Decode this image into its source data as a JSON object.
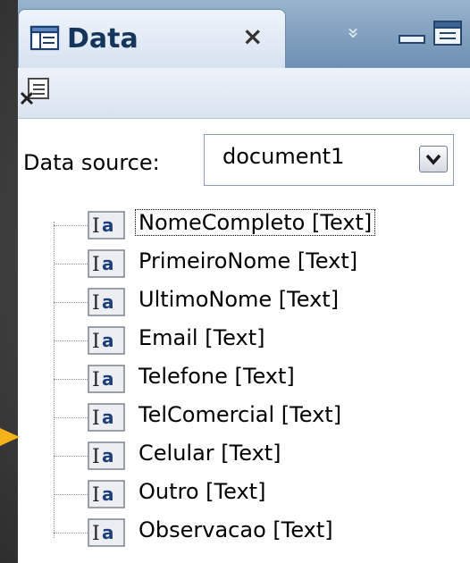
{
  "panel": {
    "title": "Data",
    "close_glyph": "×",
    "chevron_glyph": "»"
  },
  "icons": {
    "tab": "data-panel-icon",
    "toolbar": "remove-data-source-icon",
    "field": "text-field-icon"
  },
  "data_source": {
    "label": "Data source:",
    "value": "document1"
  },
  "fields": [
    {
      "label": "NomeCompleto [Text]",
      "selected": true
    },
    {
      "label": "PrimeiroNome [Text]",
      "selected": false
    },
    {
      "label": "UltimoNome [Text]",
      "selected": false
    },
    {
      "label": "Email [Text]",
      "selected": false
    },
    {
      "label": "Telefone [Text]",
      "selected": false
    },
    {
      "label": "TelComercial [Text]",
      "selected": false
    },
    {
      "label": "Celular [Text]",
      "selected": false
    },
    {
      "label": "Outro [Text]",
      "selected": false
    },
    {
      "label": "Observacao [Text]",
      "selected": false
    }
  ],
  "colors": {
    "accent_arrow": "#f5b21b",
    "tab_title": "#15355a"
  }
}
